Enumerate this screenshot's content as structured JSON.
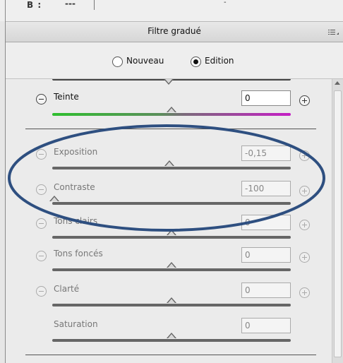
{
  "top_strip": {
    "label": "B :",
    "value": "---",
    "dash": "-"
  },
  "header": {
    "title": "Filtre gradué",
    "menu_icon": "panel-menu-icon"
  },
  "mode": {
    "options": [
      {
        "label": "Nouveau",
        "selected": false
      },
      {
        "label": "Edition",
        "selected": true
      }
    ]
  },
  "sliders": [
    {
      "label": "Teinte",
      "value": "0",
      "enabled": true,
      "track": "hue-gradient",
      "level": 0.5
    },
    {
      "label": "Exposition",
      "value": "-0,15",
      "enabled": false,
      "level": 0.49
    },
    {
      "label": "Contraste",
      "value": "-100",
      "enabled": false,
      "level": 0.0
    },
    {
      "label": "Tons clairs",
      "value": "0",
      "enabled": false,
      "level": 0.5
    },
    {
      "label": "Tons foncés",
      "value": "0",
      "enabled": false,
      "level": 0.5
    },
    {
      "label": "Clarté",
      "value": "0",
      "enabled": false,
      "level": 0.5
    },
    {
      "label": "Saturation",
      "value": "0",
      "enabled": false,
      "level": 0.5
    }
  ],
  "colors": {
    "annotation_oval": "#2e4f80",
    "hue_track_start": "#2fbf2f",
    "hue_track_end": "#c51ec5"
  }
}
